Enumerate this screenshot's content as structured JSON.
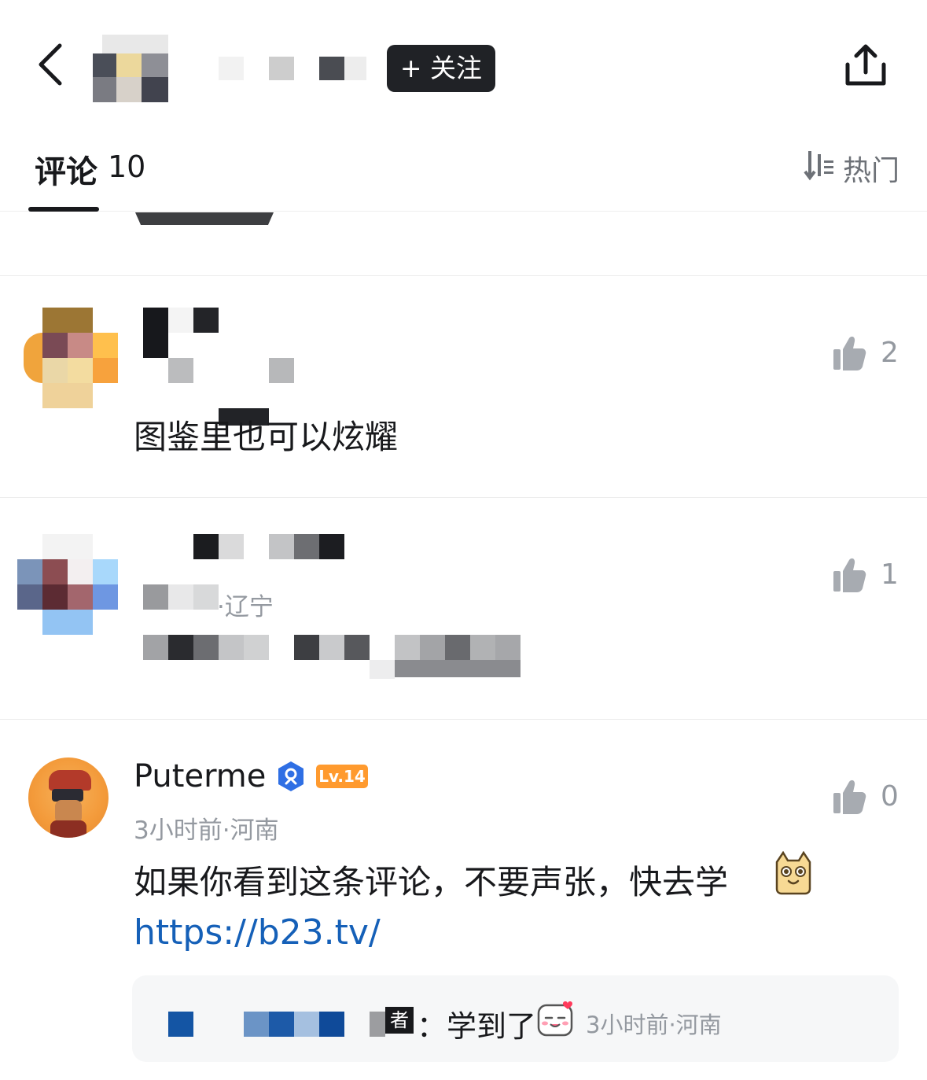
{
  "header": {
    "follow_label": "+ 关注",
    "back_icon": "chevron-left-icon",
    "share_icon": "share-upload-icon"
  },
  "tabs": {
    "comments_label": "评论",
    "comments_count": "10",
    "sort_label": "热门",
    "sort_icon": "sort-icon"
  },
  "comments": [
    {
      "content_partial": "图鉴里也可以炫耀",
      "likes": "2"
    },
    {
      "meta_location": "·辽宁",
      "likes": "1"
    },
    {
      "username": "Puterme",
      "level": "Lv.14",
      "meta": "3小时前·河南",
      "content": "如果你看到这条评论，不要声张，快去学",
      "link": "https://b23.tv/",
      "likes": "0",
      "reply": {
        "tag": "者",
        "text": "：学到了",
        "meta": "3小时前·河南"
      }
    }
  ],
  "colors": {
    "link": "#1560b8",
    "level_badge": "#ff9a2e",
    "verified": "#2f6fe4",
    "muted": "#9499a0"
  }
}
